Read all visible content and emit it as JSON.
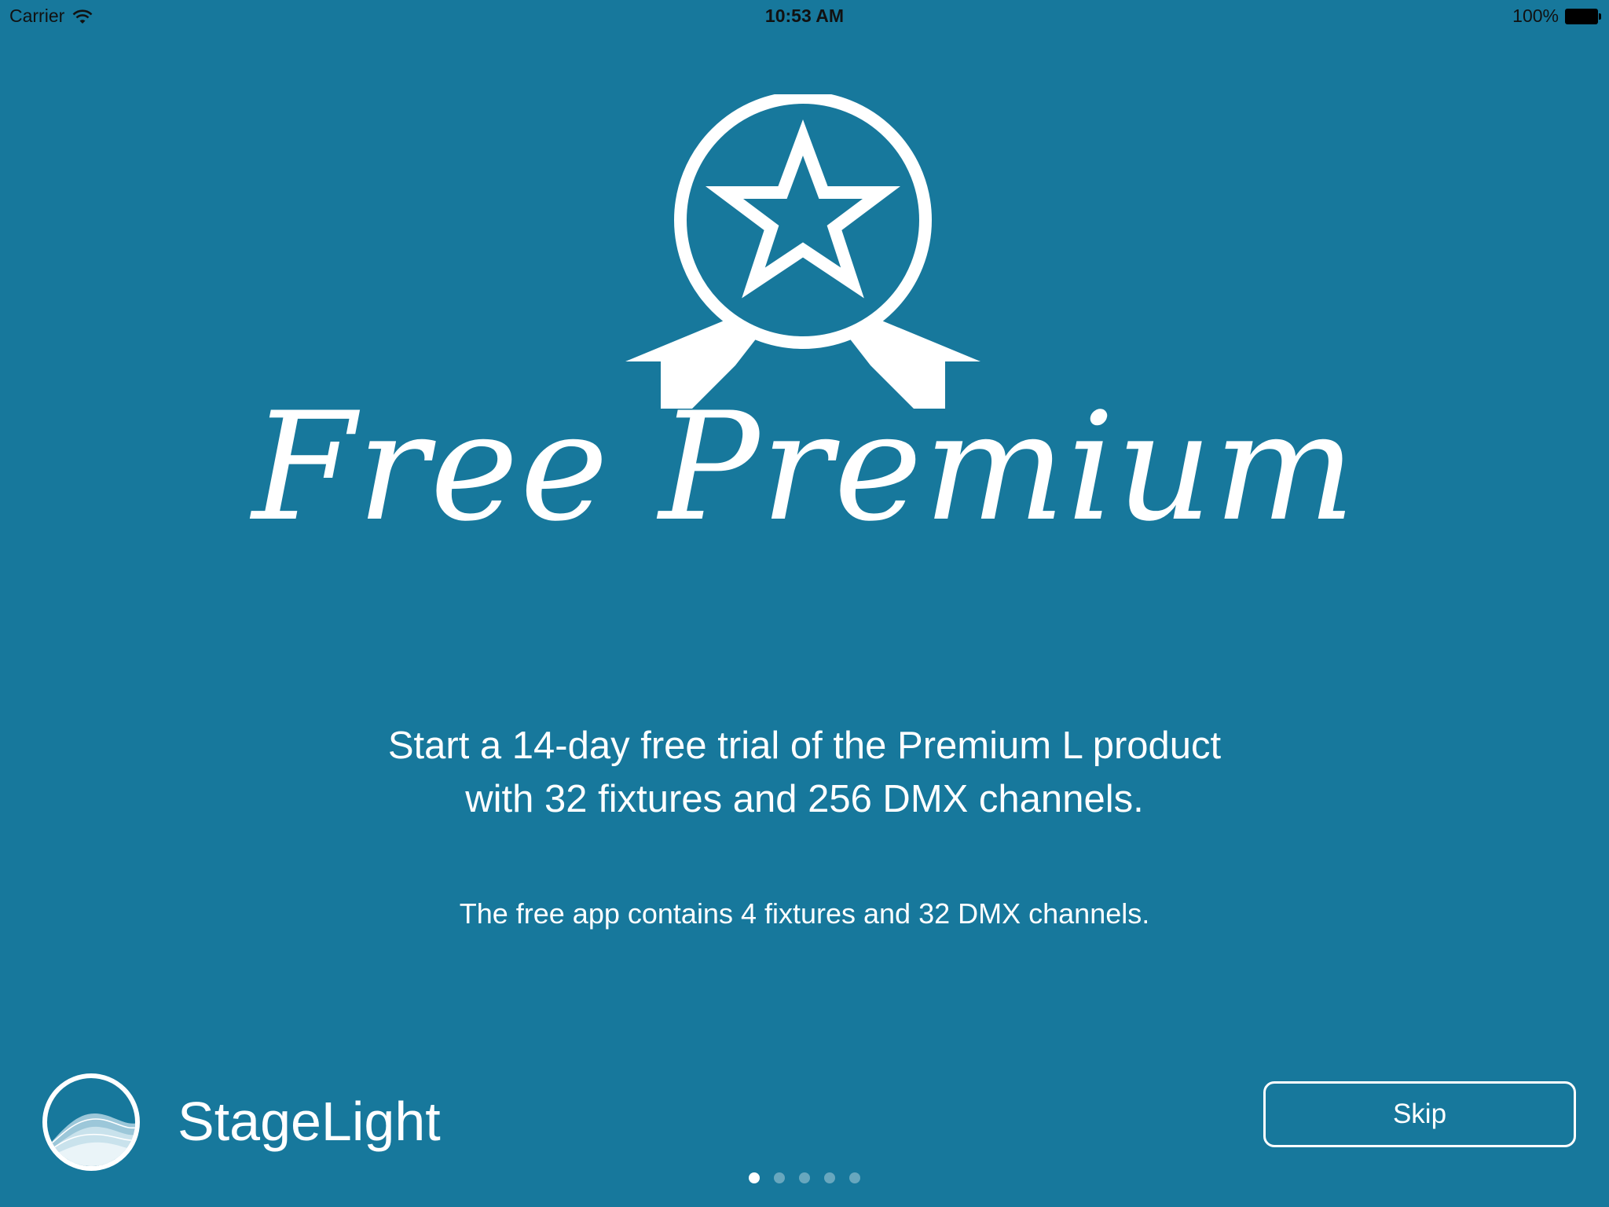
{
  "status_bar": {
    "carrier": "Carrier",
    "time": "10:53 AM",
    "battery": "100%"
  },
  "hero": {
    "icon": "award-ribbon-star-icon",
    "title": "Free Premium"
  },
  "description": {
    "line1": "Start a 14-day free trial of the Premium L product",
    "line2": "with 32 fixtures and 256 DMX channels.",
    "note": "The free app contains 4 fixtures and 32 DMX channels."
  },
  "footer": {
    "app_name": "StageLight",
    "skip_label": "Skip",
    "pages": 5,
    "current_page": 1
  },
  "colors": {
    "background": "#17789c",
    "foreground": "#ffffff"
  }
}
